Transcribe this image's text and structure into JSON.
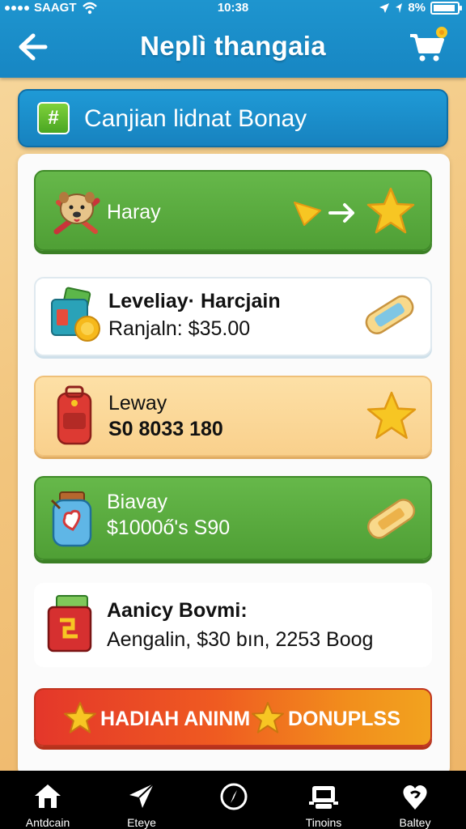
{
  "status_bar": {
    "carrier": "SAAGT",
    "time": "10:38",
    "battery": "8%"
  },
  "header": {
    "title": "Neplì thangaia"
  },
  "banner": {
    "badge_symbol": "#",
    "text": "Canjian lidnat Bonay"
  },
  "cards": [
    {
      "style": "green",
      "line1": "Haray",
      "line2": "",
      "icon": "dog-avatar-icon",
      "right_icons": [
        "arrow-icon",
        "star-icon"
      ]
    },
    {
      "style": "white",
      "line1": "Leveliay· Harcjain",
      "line2": "Ranjaln: $35.00",
      "icon": "cash-box-icon",
      "right_icons": [
        "ticket-icon"
      ]
    },
    {
      "style": "peach",
      "line1": "Leway",
      "line2": "S0 8033 180",
      "icon": "backpack-icon",
      "right_icons": [
        "star-icon"
      ]
    },
    {
      "style": "green",
      "line1": "Biavay",
      "line2": "$1000ő's S90",
      "icon": "jar-icon",
      "right_icons": [
        "ticket-icon"
      ]
    },
    {
      "style": "plain",
      "line1": "Aanicy Bovmi:",
      "line2": "Aengalin, $30  bın, 2253 Boog",
      "icon": "gift-box-icon",
      "right_icons": []
    }
  ],
  "cta": {
    "label_left": "HADIAH ANINM",
    "label_right": "DONUPLSS"
  },
  "nav": [
    {
      "label": "Antdcain",
      "icon": "home-icon"
    },
    {
      "label": "Eteye",
      "icon": "send-icon"
    },
    {
      "label": "",
      "icon": "compass-icon"
    },
    {
      "label": "Tinoins",
      "icon": "robot-icon"
    },
    {
      "label": "Baltey",
      "icon": "heart-pin-icon"
    }
  ],
  "colors": {
    "header": "#1786c3",
    "green_card": "#5aab3f",
    "peach_card": "#fbd898",
    "cta_start": "#e4372a",
    "cta_end": "#f2a31f",
    "star": "#f7c623"
  }
}
